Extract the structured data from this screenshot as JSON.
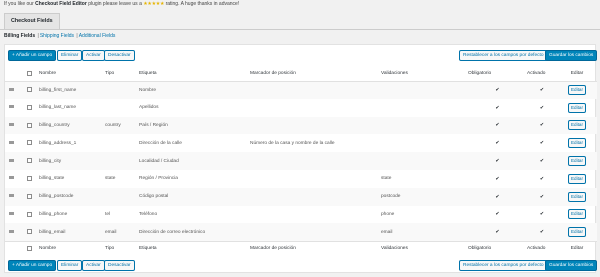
{
  "notice": {
    "prefix": "If you like our",
    "plugin_name": "Checkout Field Editor",
    "middle": "plugin please leave us a",
    "stars": "★★★★★",
    "suffix": "rating. A huge thanks in advance!"
  },
  "tabs": [
    {
      "label": "Checkout Fields"
    }
  ],
  "subnav": [
    {
      "label": "Billing Fields"
    },
    {
      "label": "Shipping Fields"
    },
    {
      "label": "Additional Fields"
    }
  ],
  "subnav_sep": "|",
  "toolbar": {
    "add": "+ Añadir un campo",
    "delete": "Eliminar",
    "enable": "Activar",
    "disable": "Desactivar",
    "reset": "Restablecer a los campos por defecto",
    "save": "Guardar los cambios"
  },
  "columns": {
    "name": "Nombre",
    "type": "Tipo",
    "label": "Etiqueta",
    "placeholder": "Marcador de posición",
    "validations": "Validaciones",
    "required": "Obligatorio",
    "enabled": "Activado",
    "edit": "Editar"
  },
  "check_glyph": "✔",
  "rows": [
    {
      "name": "billing_first_name",
      "type": "",
      "label": "Nombre",
      "placeholder": "",
      "validations": "",
      "required": true,
      "enabled": true,
      "edit": "Editar"
    },
    {
      "name": "billing_last_name",
      "type": "",
      "label": "Apellidos",
      "placeholder": "",
      "validations": "",
      "required": true,
      "enabled": true,
      "edit": "Editar"
    },
    {
      "name": "billing_country",
      "type": "country",
      "label": "País / Región",
      "placeholder": "",
      "validations": "",
      "required": true,
      "enabled": true,
      "edit": "Editar"
    },
    {
      "name": "billing_address_1",
      "type": "",
      "label": "Dirección de la calle",
      "placeholder": "Número de la casa y nombre de la calle",
      "validations": "",
      "required": true,
      "enabled": true,
      "edit": "Editar"
    },
    {
      "name": "billing_city",
      "type": "",
      "label": "Localidad / Ciudad",
      "placeholder": "",
      "validations": "",
      "required": true,
      "enabled": true,
      "edit": "Editar"
    },
    {
      "name": "billing_state",
      "type": "state",
      "label": "Región / Provincia",
      "placeholder": "",
      "validations": "state",
      "required": true,
      "enabled": true,
      "edit": "Editar"
    },
    {
      "name": "billing_postcode",
      "type": "",
      "label": "Código postal",
      "placeholder": "",
      "validations": "postcode",
      "required": true,
      "enabled": true,
      "edit": "Editar"
    },
    {
      "name": "billing_phone",
      "type": "tel",
      "label": "Teléfono",
      "placeholder": "",
      "validations": "phone",
      "required": true,
      "enabled": true,
      "edit": "Editar"
    },
    {
      "name": "billing_email",
      "type": "email",
      "label": "Dirección de correo electrónico",
      "placeholder": "",
      "validations": "email",
      "required": true,
      "enabled": true,
      "edit": "Editar"
    }
  ],
  "colors": {
    "link": "#0073aa",
    "primary": "#0085ba",
    "stars": "#e6b400"
  }
}
